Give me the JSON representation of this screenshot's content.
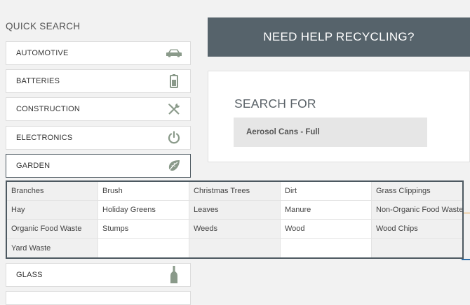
{
  "quick_search": {
    "title": "QUICK SEARCH",
    "categories": [
      {
        "label": "AUTOMOTIVE",
        "icon": "car-icon"
      },
      {
        "label": "BATTERIES",
        "icon": "battery-icon"
      },
      {
        "label": "CONSTRUCTION",
        "icon": "tools-icon"
      },
      {
        "label": "ELECTRONICS",
        "icon": "power-icon"
      },
      {
        "label": "GARDEN",
        "icon": "leaf-icon",
        "active": true
      },
      {
        "label": "GLASS",
        "icon": "bottle-icon"
      }
    ]
  },
  "help_banner": {
    "label": "NEED HELP RECYCLING?"
  },
  "search": {
    "label": "SEARCH FOR",
    "value": "Aerosol Cans - Full"
  },
  "garden_items": [
    "Branches",
    "Brush",
    "Christmas Trees",
    "Dirt",
    "Grass Clippings",
    "Hay",
    "Holiday Greens",
    "Leaves",
    "Manure",
    "Non-Organic Food Waste",
    "Organic Food Waste",
    "Stumps",
    "Weeds",
    "Wood",
    "Wood Chips",
    "Yard Waste",
    "",
    "",
    "",
    ""
  ],
  "colors": {
    "banner": "#56636b",
    "icon": "#8a9a8a",
    "active_border": "#4d5961",
    "background": "#f2f2f2"
  }
}
